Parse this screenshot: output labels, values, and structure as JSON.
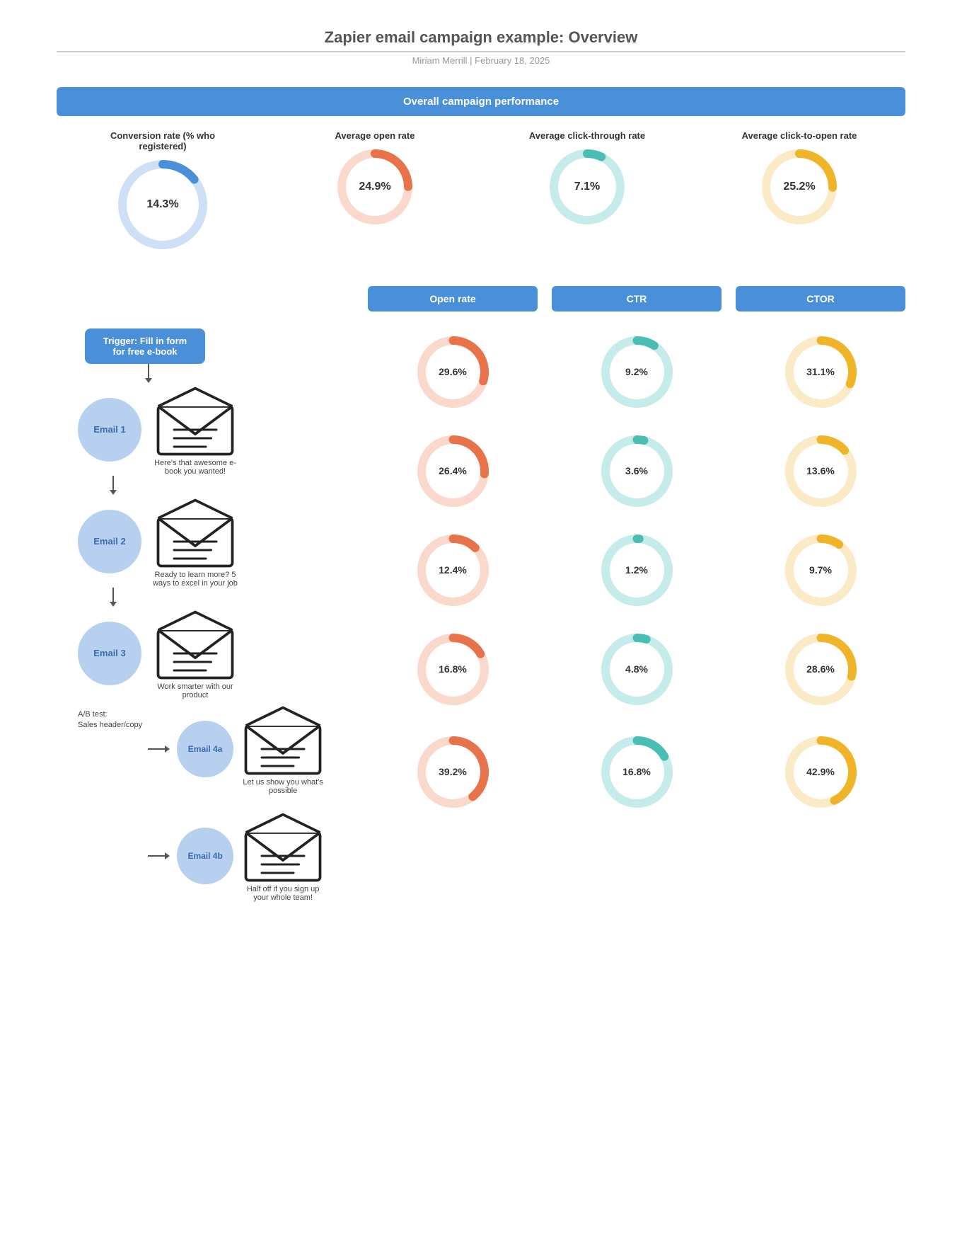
{
  "page": {
    "title": "Zapier email campaign example: Overview",
    "subtitle": "Miriam Merrill  |  February 18, 2025"
  },
  "overall": {
    "header": "Overall campaign performance",
    "stats": [
      {
        "label": "Conversion rate (% who registered)",
        "value": "14.3%",
        "percent": 14.3,
        "color": "#4a90d9",
        "trackColor": "#cde0f5",
        "size": 130
      },
      {
        "label": "Average open rate",
        "value": "24.9%",
        "percent": 24.9,
        "color": "#e8724a",
        "trackColor": "#fad9cc",
        "size": 110
      },
      {
        "label": "Average click-through rate",
        "value": "7.1%",
        "percent": 7.1,
        "color": "#4abdb5",
        "trackColor": "#c5ecea",
        "size": 110
      },
      {
        "label": "Average click-to-open rate",
        "value": "25.2%",
        "percent": 25.2,
        "color": "#f0b429",
        "trackColor": "#faeac5",
        "size": 110
      }
    ]
  },
  "trigger": {
    "label": "Trigger: Fill in form for free e-book"
  },
  "columns": {
    "open_rate": "Open rate",
    "ctr": "CTR",
    "ctor": "CTOR"
  },
  "emails": [
    {
      "id": "email1",
      "name": "Email 1",
      "desc": "Here's that awesome e-book you wanted!",
      "open_rate": {
        "value": "29.6%",
        "percent": 29.6,
        "color": "#e8724a",
        "trackColor": "#fad9cc"
      },
      "ctr": {
        "value": "9.2%",
        "percent": 9.2,
        "color": "#4abdb5",
        "trackColor": "#c5ecea"
      },
      "ctor": {
        "value": "31.1%",
        "percent": 31.1,
        "color": "#f0b429",
        "trackColor": "#faeac5"
      }
    },
    {
      "id": "email2",
      "name": "Email 2",
      "desc": "Ready to learn more? 5 ways to excel in your job",
      "open_rate": {
        "value": "26.4%",
        "percent": 26.4,
        "color": "#e8724a",
        "trackColor": "#fad9cc"
      },
      "ctr": {
        "value": "3.6%",
        "percent": 3.6,
        "color": "#4abdb5",
        "trackColor": "#c5ecea"
      },
      "ctor": {
        "value": "13.6%",
        "percent": 13.6,
        "color": "#f0b429",
        "trackColor": "#faeac5"
      }
    },
    {
      "id": "email3",
      "name": "Email 3",
      "desc": "Work smarter with our product",
      "open_rate": {
        "value": "12.4%",
        "percent": 12.4,
        "color": "#e8724a",
        "trackColor": "#fad9cc"
      },
      "ctr": {
        "value": "1.2%",
        "percent": 1.2,
        "color": "#4abdb5",
        "trackColor": "#c5ecea"
      },
      "ctor": {
        "value": "9.7%",
        "percent": 9.7,
        "color": "#f0b429",
        "trackColor": "#faeac5"
      }
    },
    {
      "id": "email4a",
      "name": "Email 4a",
      "desc": "Let us show you what's possible",
      "ab_label": "A/B test:\nSales header/copy",
      "open_rate": {
        "value": "16.8%",
        "percent": 16.8,
        "color": "#e8724a",
        "trackColor": "#fad9cc"
      },
      "ctr": {
        "value": "4.8%",
        "percent": 4.8,
        "color": "#4abdb5",
        "trackColor": "#c5ecea"
      },
      "ctor": {
        "value": "28.6%",
        "percent": 28.6,
        "color": "#f0b429",
        "trackColor": "#faeac5"
      }
    },
    {
      "id": "email4b",
      "name": "Email 4b",
      "desc": "Half off if you sign up your whole team!",
      "open_rate": {
        "value": "39.2%",
        "percent": 39.2,
        "color": "#e8724a",
        "trackColor": "#fad9cc"
      },
      "ctr": {
        "value": "16.8%",
        "percent": 16.8,
        "color": "#4abdb5",
        "trackColor": "#c5ecea"
      },
      "ctor": {
        "value": "42.9%",
        "percent": 42.9,
        "color": "#f0b429",
        "trackColor": "#faeac5"
      }
    }
  ]
}
